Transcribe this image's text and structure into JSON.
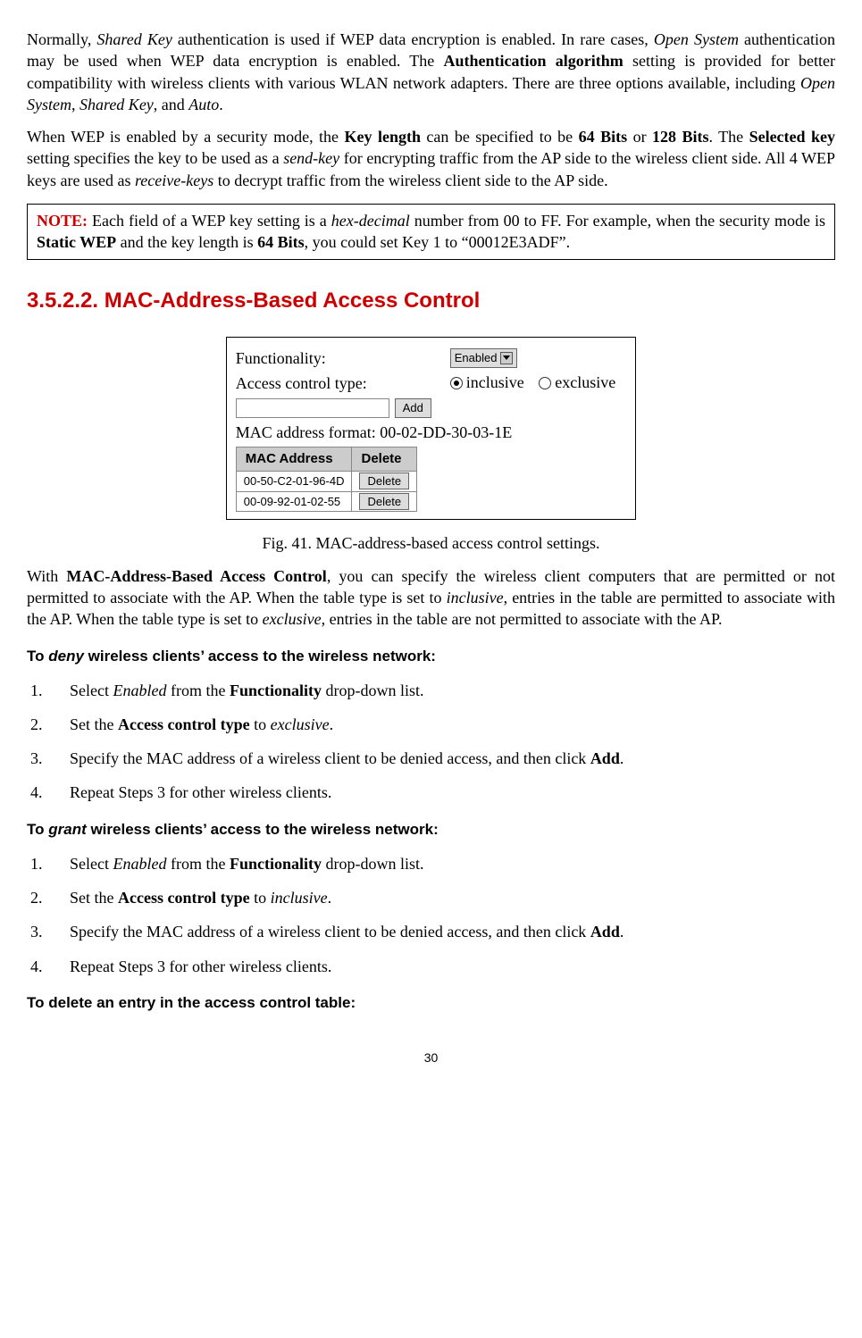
{
  "para1": {
    "t1": "Normally, ",
    "t2": "Shared Key",
    "t3": " authentication is used if WEP data encryption is enabled. In rare cases, ",
    "t4": "Open System",
    "t5": " authentication may be used when WEP data encryption is enabled. The ",
    "t6": "Authentication algorithm",
    "t7": " setting is provided for better compatibility with wireless clients with various WLAN network adapters. There are three options available, including ",
    "t8": "Open System",
    "t9": ", ",
    "t10": "Shared Key",
    "t11": ", and ",
    "t12": "Auto",
    "t13": "."
  },
  "para2": {
    "t1": "When WEP is enabled by a security mode, the ",
    "t2": "Key length",
    "t3": " can be specified to be ",
    "t4": "64 Bits",
    "t5": " or ",
    "t6": "128 Bits",
    "t7": ". The ",
    "t8": "Selected key",
    "t9": " setting specifies the key to be used as a ",
    "t10": "send-key",
    "t11": " for encrypting traffic from the AP side to the wireless client side. All 4 WEP keys are used as ",
    "t12": "receive-keys",
    "t13": " to decrypt traffic from the wireless client side to the AP side."
  },
  "note": {
    "label": "NOTE:",
    "t1": " Each field of a WEP key setting is a ",
    "t2": "hex-decimal",
    "t3": " number from 00 to FF. For example, when the security mode is ",
    "t4": "Static WEP",
    "t5": " and the key length is ",
    "t6": "64 Bits",
    "t7": ", you could set Key 1 to “00012E3ADF”."
  },
  "section_heading": "3.5.2.2. MAC-Address-Based Access Control",
  "figure": {
    "functionality_label": "Functionality:",
    "functionality_value": "Enabled",
    "acl_type_label": "Access control type:",
    "radio_inclusive": "inclusive",
    "radio_exclusive": "exclusive",
    "add_btn": "Add",
    "fmt_note": "MAC address format: 00-02-DD-30-03-1E",
    "th_mac": "MAC Address",
    "th_del": "Delete",
    "row1_mac": "00-50-C2-01-96-4D",
    "row1_btn": "Delete",
    "row2_mac": "00-09-92-01-02-55",
    "row2_btn": "Delete",
    "caption": "Fig. 41. MAC-address-based access control settings."
  },
  "para3": {
    "t1": "With ",
    "t2": "MAC-Address-Based Access Control",
    "t3": ", you can specify the wireless client computers that are permitted or not permitted to associate with the AP. When the table type is set to ",
    "t4": "inclusive",
    "t5": ", entries in the table are permitted to associate with the AP. When the table type is set to ",
    "t6": "exclusive",
    "t7": ", entries in the table are not permitted to associate with the AP."
  },
  "deny_heading": {
    "t1": "To ",
    "t2": "deny",
    "t3": " wireless clients’ access to the wireless network:"
  },
  "deny_steps": {
    "s1": {
      "t1": "Select ",
      "t2": "Enabled",
      "t3": " from the ",
      "t4": "Functionality",
      "t5": " drop-down list."
    },
    "s2": {
      "t1": "Set the ",
      "t2": "Access control type",
      "t3": " to ",
      "t4": "exclusive",
      "t5": "."
    },
    "s3": {
      "t1": "Specify the MAC address of a wireless client to be denied access, and then click ",
      "t2": "Add",
      "t3": "."
    },
    "s4": {
      "t1": "Repeat Steps 3 for other wireless clients."
    }
  },
  "grant_heading": {
    "t1": "To ",
    "t2": "grant",
    "t3": " wireless clients’ access to the wireless network:"
  },
  "grant_steps": {
    "s1": {
      "t1": "Select ",
      "t2": "Enabled",
      "t3": " from the ",
      "t4": "Functionality",
      "t5": " drop-down list."
    },
    "s2": {
      "t1": "Set the ",
      "t2": "Access control type",
      "t3": " to ",
      "t4": "inclusive",
      "t5": "."
    },
    "s3": {
      "t1": "Specify the MAC address of a wireless client to be denied access, and then click ",
      "t2": "Add",
      "t3": "."
    },
    "s4": {
      "t1": "Repeat Steps 3 for other wireless clients."
    }
  },
  "delete_heading": "To delete an entry in the access control table:",
  "page_number": "30"
}
